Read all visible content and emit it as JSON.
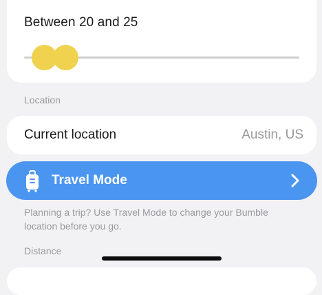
{
  "age_filter": {
    "label": "Between 20 and 25",
    "min": 20,
    "max": 25
  },
  "location_section": {
    "header": "Location",
    "row_label": "Current location",
    "row_value": "Austin, US"
  },
  "travel_mode": {
    "label": "Travel Mode",
    "icon": "suitcase-icon",
    "chevron": "chevron-right-icon",
    "help_text": "Planning a trip? Use Travel Mode to change your Bumble location before you go."
  },
  "distance_section": {
    "header": "Distance"
  },
  "colors": {
    "accent_yellow": "#f0d24e",
    "travel_blue": "#4a95f0",
    "background": "#f2f2f4",
    "muted_text": "#9a9a9e"
  }
}
